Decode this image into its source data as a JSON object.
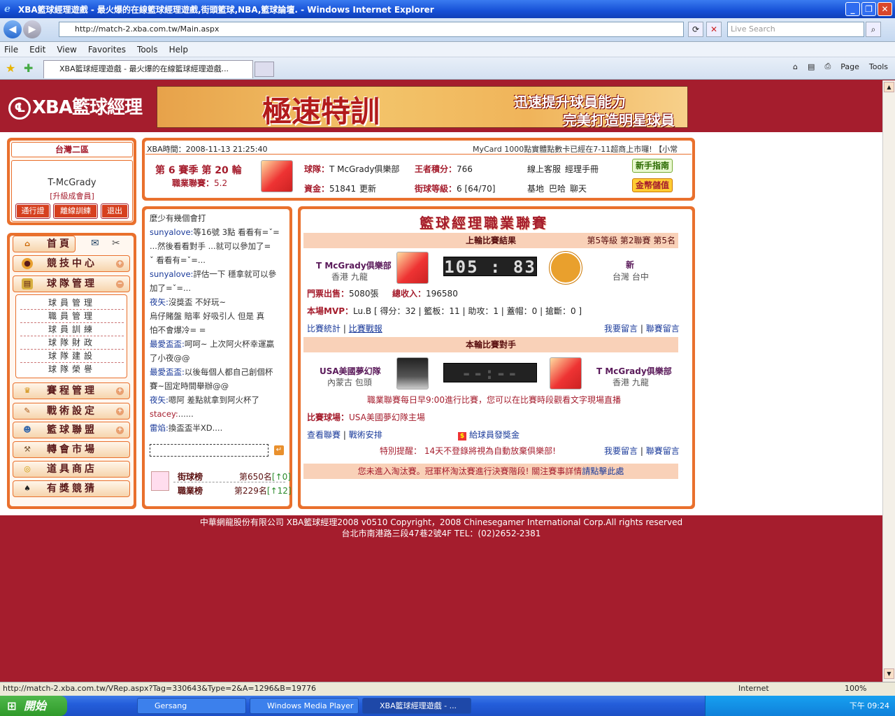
{
  "window": {
    "title": "XBA籃球經理遊戲 - 最火爆的在線籃球經理遊戲,街頭籃球,NBA,籃球論壇. - Windows Internet Explorer"
  },
  "browser": {
    "url": "http://match-2.xba.com.tw/Main.aspx",
    "search_placeholder": "Live Search",
    "menu": [
      "File",
      "Edit",
      "View",
      "Favorites",
      "Tools",
      "Help"
    ],
    "tab_title": "XBA籃球經理遊戲 - 最火爆的在線籃球經理遊戲...",
    "tools": {
      "page": "Page",
      "tools": "Tools"
    },
    "status_url": "http://match-2.xba.com.tw/VRep.aspx?Tag=330643&Type=2&A=1296&B=19776",
    "status_zone": "Internet",
    "zoom": "100%"
  },
  "banner": {
    "logo": "XBA籃球經理",
    "headline": "極速特訓",
    "line1": "迅速提升球員能力",
    "line2": "完美打造明星球員"
  },
  "user": {
    "server": "台灣二區",
    "name": "T-McGrady",
    "rank": "[升級成會員]",
    "btn_pass": "通行證",
    "btn_offline": "離線訓練",
    "btn_exit": "退出"
  },
  "nav": {
    "home": "首頁",
    "items": [
      "競技中心",
      "球隊管理",
      "賽程管理",
      "戰術設定",
      "籃球聯盟",
      "轉會市場",
      "道具商店",
      "有獎競猜"
    ],
    "sub": [
      "球員管理",
      "職員管理",
      "球員訓練",
      "球隊財政",
      "球隊建設",
      "球隊榮譽"
    ]
  },
  "topinfo": {
    "time_label": "XBA時間：",
    "time": "2008-11-13 21:25:40",
    "marquee": "MyCard 1000點實體點數卡已經在7-11超商上市囉! 【小常",
    "season": "第 6 賽季 第 20 輪",
    "league_label": "職業聯賽：",
    "league": "5.2",
    "team_label": "球隊：",
    "team": "T McGrady俱樂部",
    "points_label": "王者積分：",
    "points": "766",
    "cs": "線上客服",
    "manual": "經理手冊",
    "funds_label": "資金：",
    "funds": "51841",
    "refresh": "更新",
    "street_label": "街球等級：",
    "street": "6 [64/70]",
    "base": "基地",
    "bar": "巴哈",
    "chat": "聊天",
    "newbie": "新手指南",
    "topup": "金幣儲值"
  },
  "chat": {
    "msgs": [
      {
        "user": "",
        "text": "麼少有幾個會打"
      },
      {
        "user": "sunyalove:",
        "text": "等16號  3點  看看有=ˇ="
      },
      {
        "user": "",
        "text": "...然後看看對手 ...就可以參加了="
      },
      {
        "user": "",
        "text": "ˇ 看看有=ˇ=..."
      },
      {
        "user": "sunyalove:",
        "text": "評估一下 穩拿就可以參"
      },
      {
        "user": "",
        "text": "加了=ˇ=..."
      },
      {
        "user": "夜矢:",
        "text": "沒獎盃  不好玩~"
      },
      {
        "user": "",
        "text": "烏仔賭盤 賠率 好吸引人  但是 真"
      },
      {
        "user": "",
        "text": "怕不會爆冷= ="
      },
      {
        "user": "最愛盃盃:",
        "text": "呵呵~ 上次阿火杯幸運贏"
      },
      {
        "user": "",
        "text": "了小夜@@"
      },
      {
        "user": "最愛盃盃:",
        "text": "以後每個人都自己創個杯"
      },
      {
        "user": "",
        "text": "賽~固定時間舉辦@@"
      },
      {
        "user": "夜矢:",
        "text": "嗯阿  差點就拿到阿火杯了"
      },
      {
        "user": "stacey:",
        "text": "......"
      },
      {
        "user": "雷焰:",
        "text": "換盃盃半XD...."
      }
    ],
    "street_rank_label": "街球榜",
    "street_rank": "第650名",
    "street_delta": "[↑0]",
    "league_rank_label": "職業榜",
    "league_rank": "第229名",
    "league_delta": "[↑12]"
  },
  "league": {
    "title": "籃球經理職業聯賽",
    "last_title": "上輪比賽結果",
    "last_meta": "第5等級  第2聯賽  第5名",
    "home_team": "T McGrady俱樂部",
    "home_loc": "香港  九龍",
    "score": "105 : 83",
    "away_team": "新",
    "away_loc": "台灣  台中",
    "tickets_label": "門票出售：",
    "tickets": "5080張",
    "income_label": "總收入：",
    "income": "196580",
    "mvp_label": "本場MVP：",
    "mvp": "Lu.B  [ 得分：32 | 籃板：11 | 助攻：1 | 蓋帽：0 | 搶斷：0 ]",
    "stats": "比賽統計",
    "report": "比賽戰報",
    "msg": "我要留言",
    "league_msg": "聯賽留言",
    "next_title": "本輪比賽對手",
    "opp_team": "USA美國夢幻隊",
    "opp_loc": "內蒙古  包頭",
    "next_score": "--:--",
    "my_team": "T McGrady俱樂部",
    "my_loc": "香港  九龍",
    "notice": "職業聯賽每日早9:00進行比賽，您可以在比賽時段觀看文字現場直播",
    "venue_label": "比賽球場：",
    "venue": "USA美國夢幻隊主場",
    "view_league": "查看聯賽",
    "tactics": "戰術安排",
    "bonus": "給球員發獎金",
    "warn_label": "特別提醒：",
    "warn": "14天不登錄將視為自動放棄俱樂部!",
    "cup_notice": "您未進入淘汰賽。冠軍杯淘汰賽進行決賽階段! 關注賽事詳情",
    "cup_link": "請點擊此處"
  },
  "footer": {
    "line1": "中華網龍股份有限公司  XBA籃球經理2008 v0510     Copyright，2008 Chinesegamer International Corp.All rights reserved",
    "line2": "台北市南港路三段47巷2號4F TEL：(02)2652-2381"
  },
  "taskbar": {
    "start": "開始",
    "items": [
      "Gersang",
      "Windows Media Player",
      "XBA籃球經理遊戲 - ..."
    ],
    "clock": "下午 09:24"
  }
}
